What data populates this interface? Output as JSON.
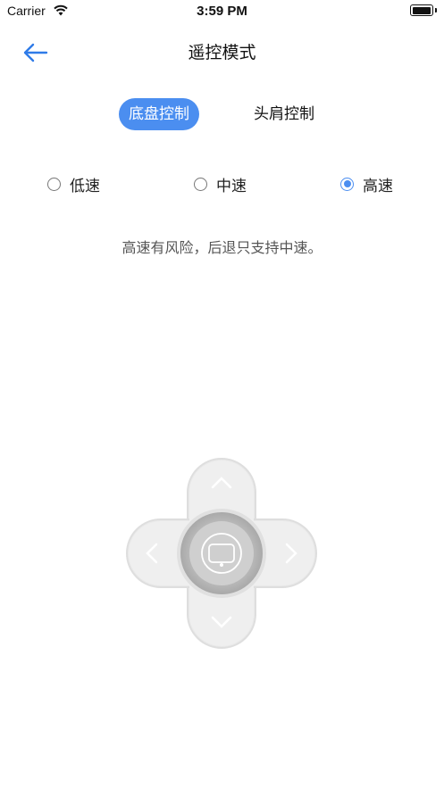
{
  "status_bar": {
    "carrier": "Carrier",
    "time": "3:59 PM"
  },
  "nav": {
    "title": "遥控模式"
  },
  "mode_tabs": [
    {
      "label": "底盘控制",
      "active": true
    },
    {
      "label": "头肩控制",
      "active": false
    }
  ],
  "speed_options": [
    {
      "label": "低速",
      "selected": false
    },
    {
      "label": "中速",
      "selected": false
    },
    {
      "label": "高速",
      "selected": true
    }
  ],
  "warning_text": "高速有风险，后退只支持中速。",
  "colors": {
    "accent": "#4b8ef0",
    "dpad": "#ececec",
    "center": "#c8c8c8"
  }
}
